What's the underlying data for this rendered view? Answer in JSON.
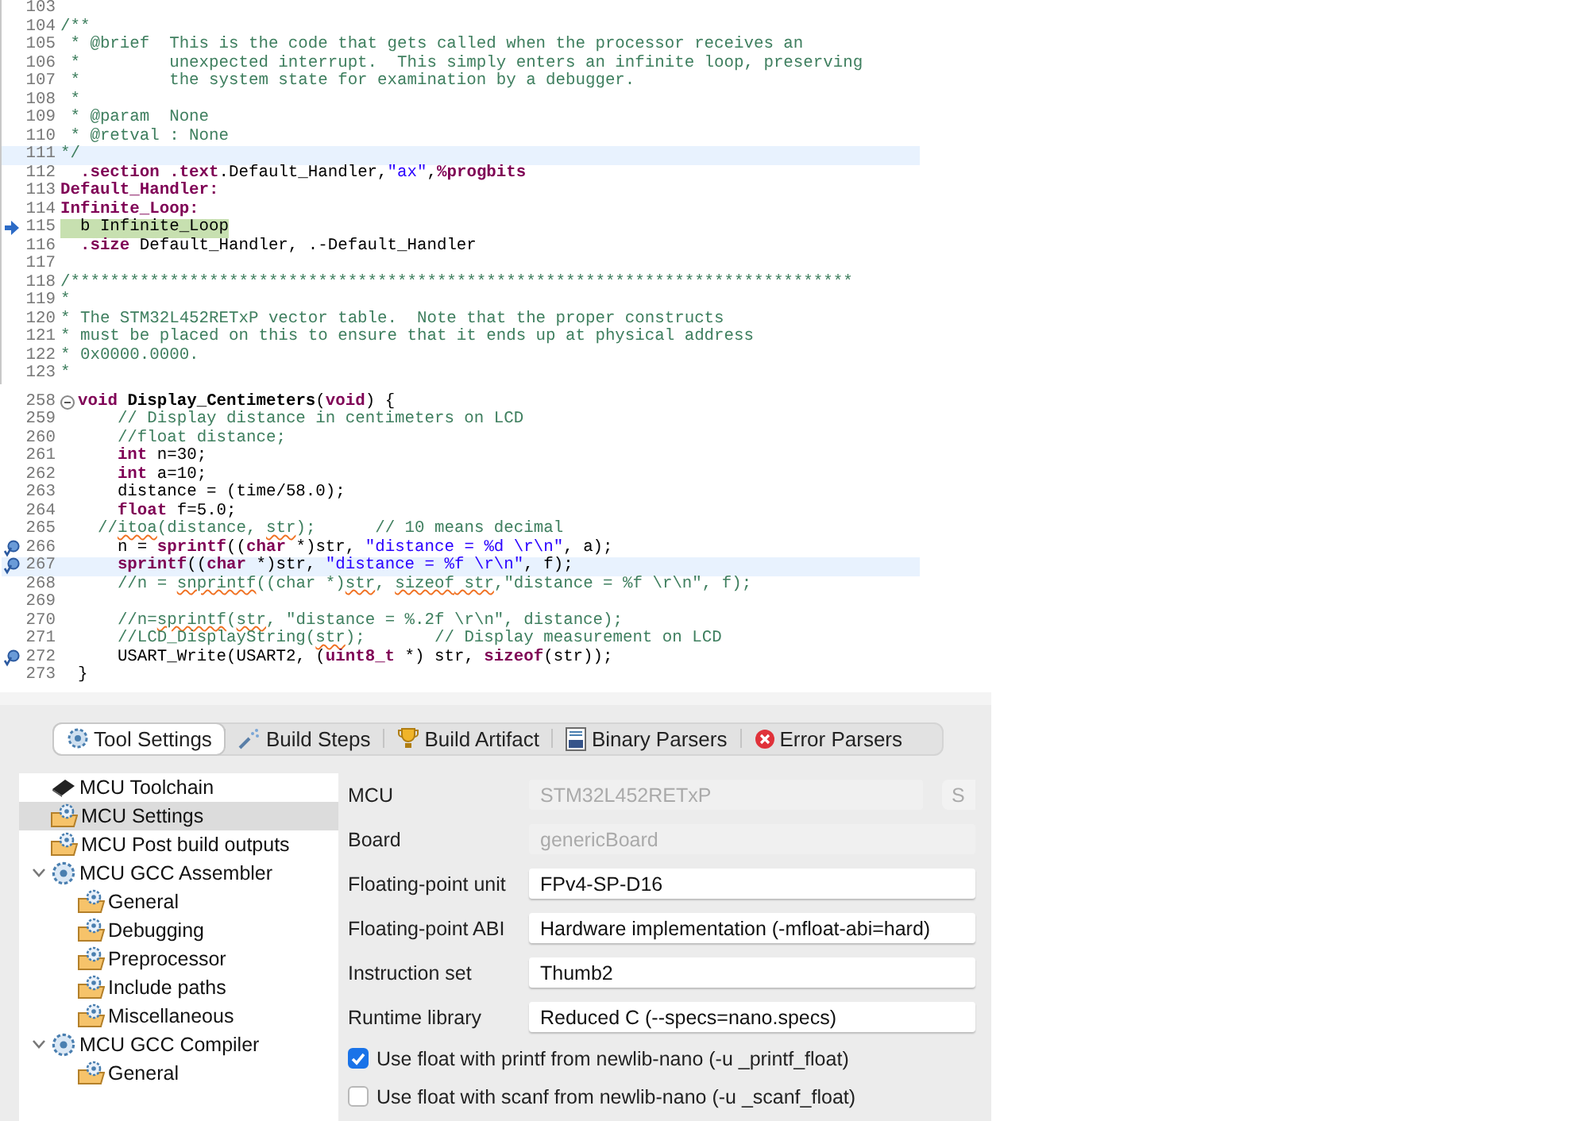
{
  "snippets": [
    {
      "lines": [
        {
          "n": "103",
          "kind": "normal"
        },
        {
          "n": "104",
          "kind": "normal",
          "tokens": [
            {
              "kind": "comment",
              "text": "/**"
            }
          ]
        },
        {
          "n": "105",
          "kind": "normal",
          "tokens": [
            {
              "kind": "comment",
              "text": " * @brief  This is the code that gets called when the processor receives an"
            }
          ]
        },
        {
          "n": "106",
          "kind": "normal",
          "tokens": [
            {
              "kind": "comment",
              "text": " *         unexpected interrupt.  This simply enters an infinite loop, preserving"
            }
          ]
        },
        {
          "n": "107",
          "kind": "normal",
          "tokens": [
            {
              "kind": "comment",
              "text": " *         the system state for examination by a debugger."
            }
          ]
        },
        {
          "n": "108",
          "kind": "normal",
          "tokens": [
            {
              "kind": "comment",
              "text": " *"
            }
          ]
        },
        {
          "n": "109",
          "kind": "normal",
          "tokens": [
            {
              "kind": "comment",
              "text": " * @param  None"
            }
          ]
        },
        {
          "n": "110",
          "kind": "normal",
          "tokens": [
            {
              "kind": "comment",
              "text": " * @retval : None"
            }
          ]
        },
        {
          "n": "111",
          "kind": "current",
          "tokens": [
            {
              "kind": "comment",
              "text": "*/"
            }
          ]
        },
        {
          "n": "112",
          "kind": "normal",
          "tokens": [
            {
              "kind": "keyword",
              "text": "  .section .text"
            },
            {
              "kind": "plain",
              "text": ".Default_Handler,"
            },
            {
              "kind": "string",
              "text": "\"ax\""
            },
            {
              "kind": "plain",
              "text": ","
            },
            {
              "kind": "keyword",
              "text": "%progbits"
            }
          ]
        },
        {
          "n": "113",
          "kind": "normal",
          "tokens": [
            {
              "kind": "keyword",
              "text": "Default_Handler:"
            }
          ]
        },
        {
          "n": "114",
          "kind": "normal",
          "tokens": [
            {
              "kind": "keyword",
              "text": "Infinite_Loop:"
            }
          ]
        },
        {
          "n": "115",
          "kind": "executing",
          "pointer": true,
          "tokens": [
            {
              "kind": "plain",
              "text": "  b Infinite_Loop"
            }
          ]
        },
        {
          "n": "116",
          "kind": "normal",
          "tokens": [
            {
              "kind": "keyword",
              "text": "  .size"
            },
            {
              "kind": "plain",
              "text": " Default_Handler, .-Default_Handler"
            }
          ]
        },
        {
          "n": "117",
          "kind": "normal"
        },
        {
          "n": "118",
          "kind": "normal",
          "tokens": [
            {
              "kind": "comment",
              "text": "/*******************************************************************************"
            }
          ]
        },
        {
          "n": "119",
          "kind": "normal",
          "tokens": [
            {
              "kind": "comment",
              "text": "*"
            }
          ]
        },
        {
          "n": "120",
          "kind": "normal",
          "tokens": [
            {
              "kind": "comment",
              "text": "* The STM32L452RETxP vector table.  Note that the proper constructs"
            }
          ]
        },
        {
          "n": "121",
          "kind": "normal",
          "tokens": [
            {
              "kind": "comment",
              "text": "* must be placed on this to ensure that it ends up at physical address"
            }
          ]
        },
        {
          "n": "122",
          "kind": "normal",
          "tokens": [
            {
              "kind": "comment",
              "text": "* 0x0000.0000."
            }
          ]
        },
        {
          "n": "123",
          "kind": "normal",
          "tokens": [
            {
              "kind": "comment",
              "text": "*"
            }
          ]
        }
      ]
    },
    {
      "lines": [
        {
          "n": "258",
          "kind": "normal",
          "foldable": true,
          "tokens": [
            {
              "kind": "keyword",
              "text": "void"
            },
            {
              "kind": "function",
              "text": " Display_Centimeters"
            },
            {
              "kind": "plain",
              "text": "("
            },
            {
              "kind": "keyword",
              "text": "void"
            },
            {
              "kind": "plain",
              "text": ") {"
            }
          ]
        },
        {
          "n": "259",
          "kind": "normal",
          "tokens": [
            {
              "kind": "comment",
              "text": "    // Display distance in centimeters on LCD"
            }
          ]
        },
        {
          "n": "260",
          "kind": "normal",
          "tokens": [
            {
              "kind": "comment",
              "text": "    //float distance;"
            }
          ]
        },
        {
          "n": "261",
          "kind": "normal",
          "tokens": [
            {
              "kind": "keyword",
              "text": "    int"
            },
            {
              "kind": "plain",
              "text": " n=30;"
            }
          ]
        },
        {
          "n": "262",
          "kind": "normal",
          "tokens": [
            {
              "kind": "keyword",
              "text": "    int"
            },
            {
              "kind": "plain",
              "text": " a=10;"
            }
          ]
        },
        {
          "n": "263",
          "kind": "normal",
          "tokens": [
            {
              "kind": "plain",
              "text": "    distance = (time/58.0);"
            }
          ]
        },
        {
          "n": "264",
          "kind": "normal",
          "tokens": [
            {
              "kind": "keyword",
              "text": "    float"
            },
            {
              "kind": "plain",
              "text": " f=5.0;"
            }
          ]
        },
        {
          "n": "265",
          "kind": "normal",
          "tokens": [
            {
              "kind": "comment",
              "text": "  //"
            },
            {
              "kind": "typo",
              "text": "itoa"
            },
            {
              "kind": "comment",
              "text": "(distance, "
            },
            {
              "kind": "typo",
              "text": "str"
            },
            {
              "kind": "comment",
              "text": ");      // 10 means decimal"
            }
          ]
        },
        {
          "n": "266",
          "kind": "normal",
          "breakpoint": true,
          "tokens": [
            {
              "kind": "plain",
              "text": "    n = "
            },
            {
              "kind": "keyword",
              "text": "sprintf"
            },
            {
              "kind": "plain",
              "text": "(("
            },
            {
              "kind": "keyword",
              "text": "char"
            },
            {
              "kind": "plain",
              "text": " *)str, "
            },
            {
              "kind": "string",
              "text": "\"distance = %d \\r\\n\""
            },
            {
              "kind": "plain",
              "text": ", a);"
            }
          ]
        },
        {
          "n": "267",
          "kind": "current",
          "breakpoint": true,
          "tokens": [
            {
              "kind": "keyword",
              "text": "    sprintf"
            },
            {
              "kind": "plain",
              "text": "(("
            },
            {
              "kind": "keyword",
              "text": "char"
            },
            {
              "kind": "plain",
              "text": " *)str, "
            },
            {
              "kind": "string",
              "text": "\"distance = %f \\r\\n\""
            },
            {
              "kind": "plain",
              "text": ", f);"
            }
          ]
        },
        {
          "n": "268",
          "kind": "normal",
          "tokens": [
            {
              "kind": "comment",
              "text": "    //n = "
            },
            {
              "kind": "typo",
              "text": "snprintf"
            },
            {
              "kind": "comment",
              "text": "((char *)"
            },
            {
              "kind": "typo",
              "text": "str"
            },
            {
              "kind": "comment",
              "text": ", "
            },
            {
              "kind": "typo",
              "text": "sizeof"
            },
            {
              "kind": "typo",
              "text": " str"
            },
            {
              "kind": "comment",
              "text": ",\"distance = %f \\r\\n\", f);"
            }
          ]
        },
        {
          "n": "269",
          "kind": "normal"
        },
        {
          "n": "270",
          "kind": "normal",
          "tokens": [
            {
              "kind": "comment",
              "text": "    //n="
            },
            {
              "kind": "typo",
              "text": "sprintf"
            },
            {
              "kind": "comment",
              "text": "("
            },
            {
              "kind": "typo",
              "text": "str"
            },
            {
              "kind": "comment",
              "text": ", \"distance = %.2f \\r\\n\", distance);"
            }
          ]
        },
        {
          "n": "271",
          "kind": "normal",
          "tokens": [
            {
              "kind": "comment",
              "text": "    //LCD_DisplayString("
            },
            {
              "kind": "typo",
              "text": "str"
            },
            {
              "kind": "comment",
              "text": ");       // Display measurement on LCD"
            }
          ]
        },
        {
          "n": "272",
          "kind": "normal",
          "breakpoint": true,
          "tokens": [
            {
              "kind": "plain",
              "text": "    USART_Write(USART2, ("
            },
            {
              "kind": "keyword",
              "text": "uint8_t"
            },
            {
              "kind": "plain",
              "text": " *) str, "
            },
            {
              "kind": "keyword",
              "text": "sizeof"
            },
            {
              "kind": "plain",
              "text": "(str));"
            }
          ]
        },
        {
          "n": "273",
          "kind": "normal",
          "tokens": [
            {
              "kind": "plain",
              "text": "}"
            }
          ]
        }
      ]
    }
  ],
  "settings": {
    "tabs": [
      {
        "label": "Tool Settings",
        "kind": "tool",
        "selected": true
      },
      {
        "label": "Build Steps",
        "kind": "steps",
        "selected": false
      },
      {
        "label": "Build Artifact",
        "kind": "artifact",
        "selected": false
      },
      {
        "label": "Binary Parsers",
        "kind": "binary",
        "selected": false
      },
      {
        "label": "Error Parsers",
        "kind": "error",
        "selected": false
      }
    ],
    "tree": [
      {
        "label": "MCU Toolchain",
        "kind": "chip",
        "selected": false
      },
      {
        "label": "MCU Settings",
        "kind": "folder",
        "selected": true
      },
      {
        "label": "MCU Post build outputs",
        "kind": "folder",
        "selected": false
      },
      {
        "label": "MCU GCC Assembler",
        "kind": "tool",
        "selected": false,
        "expanded": true,
        "children": [
          {
            "label": "General",
            "kind": "folder",
            "selected": false
          },
          {
            "label": "Debugging",
            "kind": "folder",
            "selected": false
          },
          {
            "label": "Preprocessor",
            "kind": "folder",
            "selected": false
          },
          {
            "label": "Include paths",
            "kind": "folder",
            "selected": false
          },
          {
            "label": "Miscellaneous",
            "kind": "folder",
            "selected": false
          }
        ]
      },
      {
        "label": "MCU GCC Compiler",
        "kind": "tool",
        "selected": false,
        "expanded": true,
        "children": [
          {
            "label": "General",
            "kind": "folder",
            "selected": false
          }
        ]
      }
    ],
    "fields": [
      {
        "label": "MCU",
        "value": "STM32L452RETxP",
        "disabled": true,
        "button": "S"
      },
      {
        "label": "Board",
        "value": "genericBoard",
        "disabled": true
      },
      {
        "label": "Floating-point unit",
        "value": "FPv4-SP-D16",
        "disabled": false
      },
      {
        "label": "Floating-point ABI",
        "value": "Hardware implementation (-mfloat-abi=hard)",
        "disabled": false
      },
      {
        "label": "Instruction set",
        "value": "Thumb2",
        "disabled": false
      },
      {
        "label": "Runtime library",
        "value": "Reduced C (--specs=nano.specs)",
        "disabled": false
      }
    ],
    "checkboxes": [
      {
        "label": "Use float with printf from newlib-nano (-u _printf_float)",
        "checked": true
      },
      {
        "label": "Use float with scanf from newlib-nano (-u _scanf_float)",
        "checked": false
      }
    ]
  }
}
